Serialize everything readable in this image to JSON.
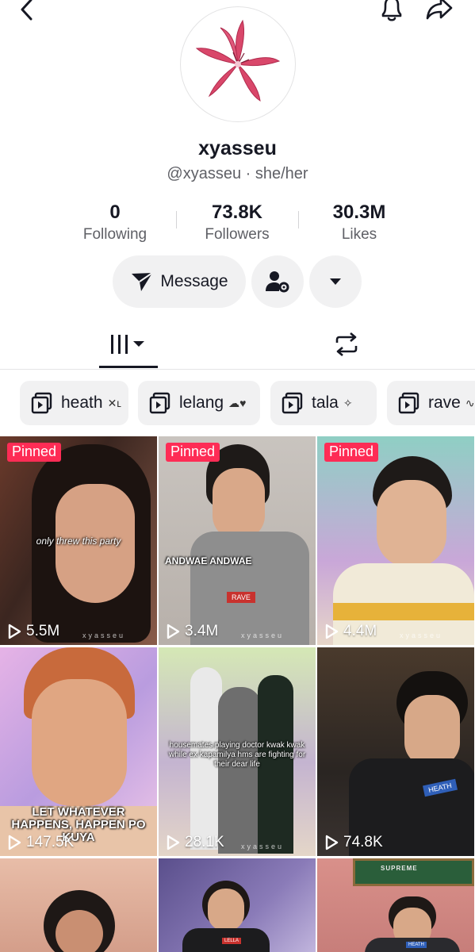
{
  "profile": {
    "username": "xyasseu",
    "handle_line": "@xyasseu · she/her"
  },
  "stats": [
    {
      "value": "0",
      "label": "Following"
    },
    {
      "value": "73.8K",
      "label": "Followers"
    },
    {
      "value": "30.3M",
      "label": "Likes"
    }
  ],
  "actions": {
    "message_label": "Message"
  },
  "collections": [
    {
      "label": "heath",
      "deco": "✕ʟ"
    },
    {
      "label": "lelang",
      "deco": "☁♥"
    },
    {
      "label": "tala",
      "deco": "✧"
    },
    {
      "label": "rave",
      "deco": "∿"
    }
  ],
  "videos": [
    {
      "pinned_label": "Pinned",
      "views": "5.5M",
      "caption": "only threw this party",
      "watermark": "xyasseu"
    },
    {
      "pinned_label": "Pinned",
      "views": "3.4M",
      "caption": "ANDWAE ANDWAE",
      "badge": "RAVE",
      "watermark": "xyasseu"
    },
    {
      "pinned_label": "Pinned",
      "views": "4.4M",
      "watermark": "xyasseu"
    },
    {
      "views": "147.5K",
      "caption": "LET WHATEVER HAPPENS, HAPPEN PO KUYA"
    },
    {
      "views": "28.1K",
      "caption": "housemates playing doctor kwak kwak while ex kapamilya hms are fighting for their dear life",
      "watermark": "xyasseu"
    },
    {
      "views": "74.8K",
      "badge": "HEATH"
    },
    {
      "views": "",
      "sign": ""
    },
    {
      "views": "",
      "badge": "LELLA"
    },
    {
      "views": "",
      "sign": "SUPREME",
      "badge": "HEATH"
    }
  ],
  "colors": {
    "accent": "#fe2c55",
    "pill_bg": "#f1f1f2",
    "text_primary": "#161823",
    "text_secondary": "#5f6066"
  }
}
